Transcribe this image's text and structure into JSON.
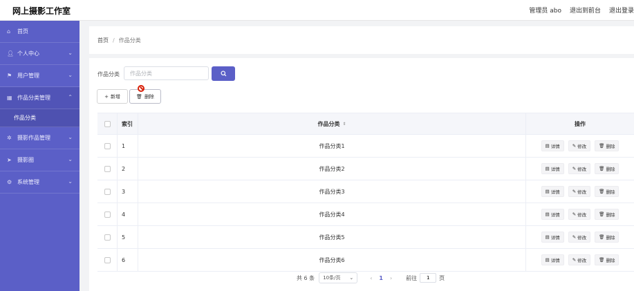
{
  "header": {
    "title": "网上摄影工作室",
    "admin": "管理员 abo",
    "back_front": "退出到前台",
    "logout": "退出登录"
  },
  "sidebar": {
    "items": [
      {
        "label": "首页",
        "icon": "home-icon"
      },
      {
        "label": "个人中心",
        "icon": "user-icon"
      },
      {
        "label": "用户管理",
        "icon": "flag-icon"
      },
      {
        "label": "作品分类管理",
        "icon": "grid-icon"
      },
      {
        "label": "摄影作品管理",
        "icon": "settings-icon"
      },
      {
        "label": "摄影圈",
        "icon": "send-icon"
      },
      {
        "label": "系统管理",
        "icon": "gear-icon"
      }
    ],
    "sub_item": "作品分类"
  },
  "breadcrumb": {
    "home": "首页",
    "sep": "/",
    "current": "作品分类"
  },
  "search": {
    "label": "作品分类",
    "placeholder": "作品分类",
    "value": ""
  },
  "toolbar": {
    "add_label": "新增",
    "delete_label": "删除"
  },
  "table": {
    "headers": {
      "index": "索引",
      "name": "作品分类",
      "ops": "操作"
    },
    "rows": [
      {
        "index": "1",
        "name": "作品分类1"
      },
      {
        "index": "2",
        "name": "作品分类2"
      },
      {
        "index": "3",
        "name": "作品分类3"
      },
      {
        "index": "4",
        "name": "作品分类4"
      },
      {
        "index": "5",
        "name": "作品分类5"
      },
      {
        "index": "6",
        "name": "作品分类6"
      }
    ],
    "ops": {
      "detail": "详情",
      "edit": "修改",
      "delete": "删除"
    }
  },
  "pagination": {
    "total": "共 6 条",
    "page_size": "10条/页",
    "current_page": "1",
    "goto_label": "前往",
    "goto_value": "1",
    "suffix": "页"
  },
  "colors": {
    "primary": "#5b5fc7",
    "danger": "#d81e06"
  }
}
